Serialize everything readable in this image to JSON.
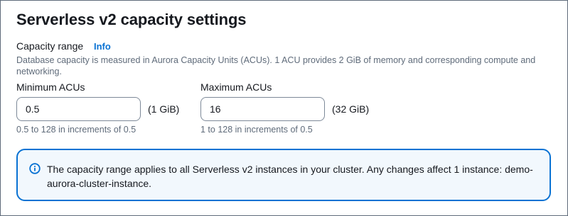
{
  "panel": {
    "title": "Serverless v2 capacity settings"
  },
  "capacity_range": {
    "label": "Capacity range",
    "info_link": "Info",
    "description": "Database capacity is measured in Aurora Capacity Units (ACUs). 1 ACU provides 2 GiB of memory and corresponding compute and networking."
  },
  "minimum": {
    "label": "Minimum ACUs",
    "value": "0.5",
    "unit": "(1 GiB)",
    "hint": "0.5 to 128 in increments of 0.5"
  },
  "maximum": {
    "label": "Maximum ACUs",
    "value": "16",
    "unit": "(32 GiB)",
    "hint": "1 to 128 in increments of 0.5"
  },
  "alert": {
    "icon": "info-icon",
    "message": "The capacity range applies to all Serverless v2 instances in your cluster. Any changes affect 1 instance: demo-aurora-cluster-instance."
  },
  "colors": {
    "accent": "#0972d3",
    "alert_background": "#f2f8fd",
    "secondary_text": "#5f6b7a",
    "border": "#7d8998"
  }
}
